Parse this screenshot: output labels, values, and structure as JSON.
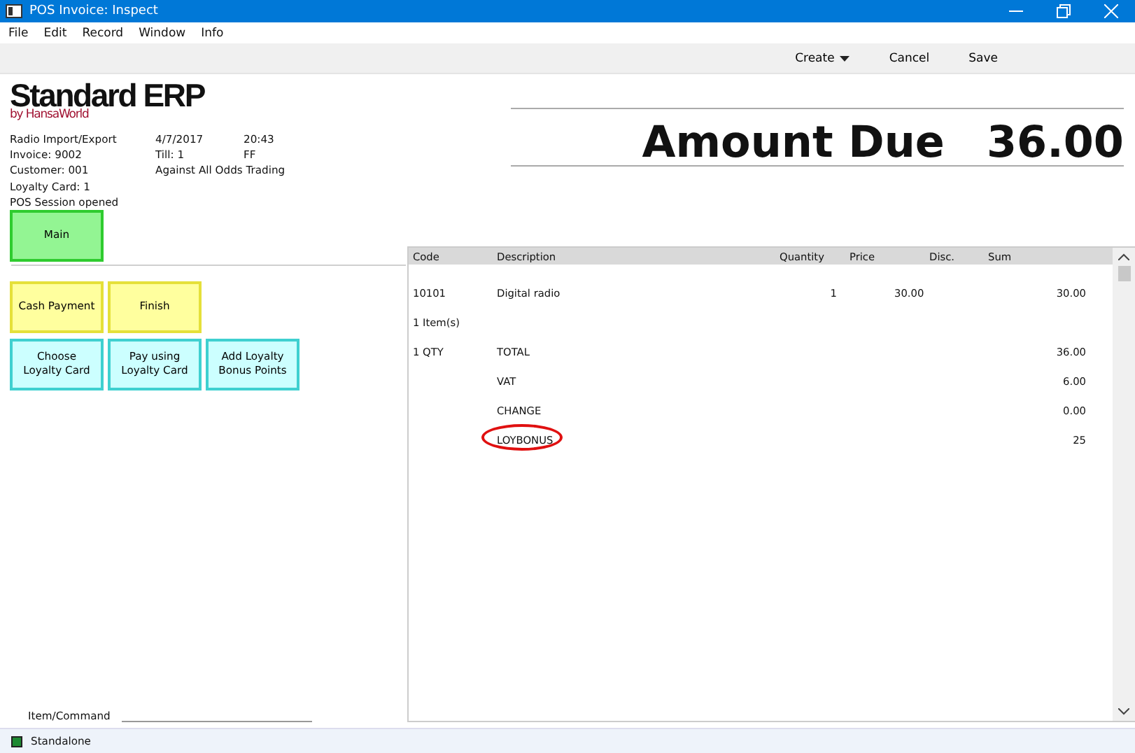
{
  "window": {
    "title": "POS Invoice: Inspect"
  },
  "menu": [
    "File",
    "Edit",
    "Record",
    "Window",
    "Info"
  ],
  "toolbar": [
    {
      "label": "Create",
      "dropdown": true
    },
    {
      "label": "Cancel",
      "dropdown": false
    },
    {
      "label": "Save",
      "dropdown": false
    }
  ],
  "logo": {
    "name": "Standard ERP",
    "byline": "by HansaWorld"
  },
  "info": [
    [
      "Radio Import/Export",
      "4/7/2017",
      "20:43"
    ],
    [
      "Invoice: 9002",
      "Till: 1",
      "FF"
    ],
    [
      "Customer: 001",
      "Against All Odds Trading"
    ],
    [
      "Loyalty Card: 1"
    ],
    [
      "POS Session opened"
    ]
  ],
  "amount_due": {
    "label": "Amount Due",
    "value": "36.00"
  },
  "menu_buttons": [
    {
      "label": "Main",
      "kind": "menu"
    }
  ],
  "button_rows": [
    [
      {
        "label": "Cash Payment",
        "kind": "action"
      },
      {
        "label": "Finish",
        "kind": "action"
      }
    ],
    [
      {
        "label": "Choose Loyalty Card",
        "kind": "loyalty"
      },
      {
        "label": "Pay using Loyalty Card",
        "kind": "loyalty"
      },
      {
        "label": "Add Loyalty Bonus Points",
        "kind": "loyalty"
      }
    ]
  ],
  "command": {
    "label": "Item/Command"
  },
  "table": {
    "columns": [
      "Code",
      "Description",
      "Quantity",
      "Price",
      "Disc.",
      "Sum"
    ],
    "rows": [
      {
        "cells": [
          "10101",
          "Digital radio",
          "1",
          "30.00",
          "",
          "30.00"
        ],
        "circled": false
      },
      {
        "cells": [
          "1 Item(s)",
          "",
          "",
          "",
          "",
          ""
        ],
        "circled": false
      },
      {
        "cells": [
          "1 QTY",
          "TOTAL",
          "",
          "",
          "",
          "36.00"
        ],
        "circled": false
      },
      {
        "cells": [
          "",
          "VAT",
          "",
          "",
          "",
          "6.00"
        ],
        "circled": false
      },
      {
        "cells": [
          "",
          "CHANGE",
          "",
          "",
          "",
          "0.00"
        ],
        "circled": false
      },
      {
        "cells": [
          "",
          "LOYBONUS",
          "",
          "",
          "",
          "25"
        ],
        "circled": true
      }
    ]
  },
  "status_bar": {
    "text": "Standalone"
  }
}
